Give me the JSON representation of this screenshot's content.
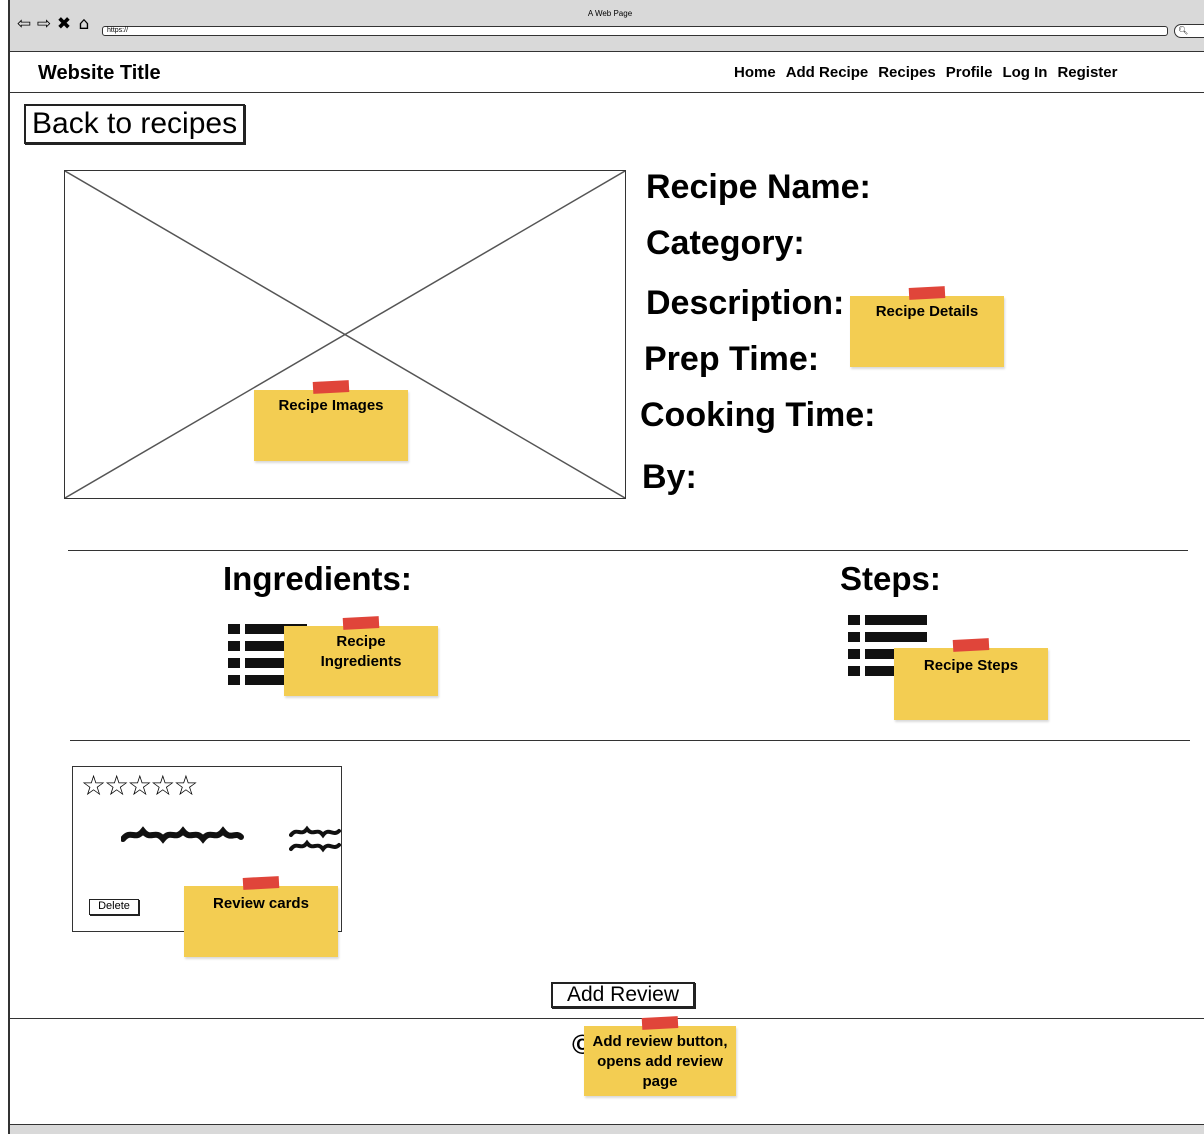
{
  "browser": {
    "window_title": "A Web Page",
    "url": "https://",
    "nav_icons": [
      "back-arrow-icon",
      "forward-arrow-icon",
      "close-icon",
      "home-icon"
    ]
  },
  "header": {
    "site_title": "Website Title",
    "nav": [
      "Home",
      "Add Recipe",
      "Recipes",
      "Profile",
      "Log In",
      "Register"
    ]
  },
  "back_button": "Back to recipes",
  "recipe_details": {
    "name_label": "Recipe Name:",
    "category_label": "Category:",
    "description_label": "Description:",
    "prep_label": "Prep Time:",
    "cooking_label": "Cooking Time:",
    "by_label": "By:"
  },
  "sections": {
    "ingredients_title": "Ingredients:",
    "steps_title": "Steps:"
  },
  "review_card": {
    "rating_stars": "☆☆☆☆☆",
    "delete_label": "Delete"
  },
  "add_review_label": "Add Review",
  "notes": {
    "images": "Recipe Images",
    "details": "Recipe Details",
    "ingredients": "Recipe Ingredients",
    "steps": "Recipe Steps",
    "reviews": "Review cards",
    "add_review": "Add review button, opens add review page"
  },
  "colors": {
    "sticky": "#f3cd52",
    "tape": "#e0453a",
    "chrome": "#d9d9d9"
  }
}
